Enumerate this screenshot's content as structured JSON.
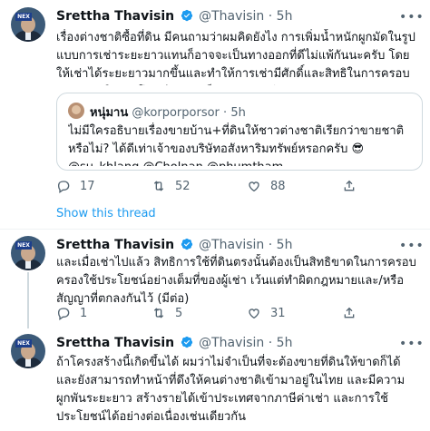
{
  "tweets": [
    {
      "name": "Srettha Thavisin",
      "handle": "@Thavisin",
      "dot": "·",
      "time": "5h",
      "text": "เรื่องต่างชาติซื้อที่ดิน มีคนถามว่าผมคิดยังไง การเพิ่มน้ำหนักผูกมัดในรูปแบบการเช่าระยะยาวแทนก็อาจจะเป็นทางออกที่ดีไม่แพ้กันนะครับ โดย ให้เช่าได้ระยะยาวมากขึ้นและทำให้การเช่ามีศักดิ์และสิทธิในการครอบครองและใช้ประโยชน์เสมือนเป็นเจ้าของ (มีต่อ)",
      "quote": {
        "name": "หนุ่มาน",
        "handle": "@korporporsor",
        "dot": "·",
        "time": "5h",
        "text": "ไม่มีใครอธิบายเรื่องขายบ้าน+ที่ดินให้ชาวต่างชาติเรียกว่าขายชาติหรือไม่? ได้ดีเท่าเจ้าของบริษัทอสังหาริมทรัพย์หรอกครับ 😎\n@su_khlang @Cholnan @phumtham twitter.com/thavisin/statu..."
      },
      "replies": "17",
      "retweets": "52",
      "likes": "88"
    },
    {
      "name": "Srettha Thavisin",
      "handle": "@Thavisin",
      "dot": "·",
      "time": "5h",
      "text": "และเมื่อเช่าไปแล้ว สิทธิการใช้ที่ดินตรงนั้นต้องเป็นสิทธิขาดในการครอบครองใช้ประโยชน์อย่างเต็มที่ของผู้เช่า เว้นแต่ทำผิดกฎหมายและ/หรือสัญญาที่ตกลงกันไว้ (มีต่อ)",
      "replies": "1",
      "retweets": "5",
      "likes": "31"
    },
    {
      "name": "Srettha Thavisin",
      "handle": "@Thavisin",
      "dot": "·",
      "time": "5h",
      "text": "ถ้าโครงสร้างนี้เกิดขึ้นได้ ผมว่าไม่จำเป็นที่จะต้องขายที่ดินให้ขาดก็ได้ และยังสามารถทำหน้าที่ดึงให้คนต่างชาติเข้ามาอยู่ในไทย และมีความผูกพันระยะยาว สร้างรายได้เข้าประเทศจากภาษีค่าเช่า และการใช้ประโยชน์ได้อย่างต่อเนื่องเช่นเดียวกัน"
    }
  ],
  "show_thread": "Show this thread"
}
